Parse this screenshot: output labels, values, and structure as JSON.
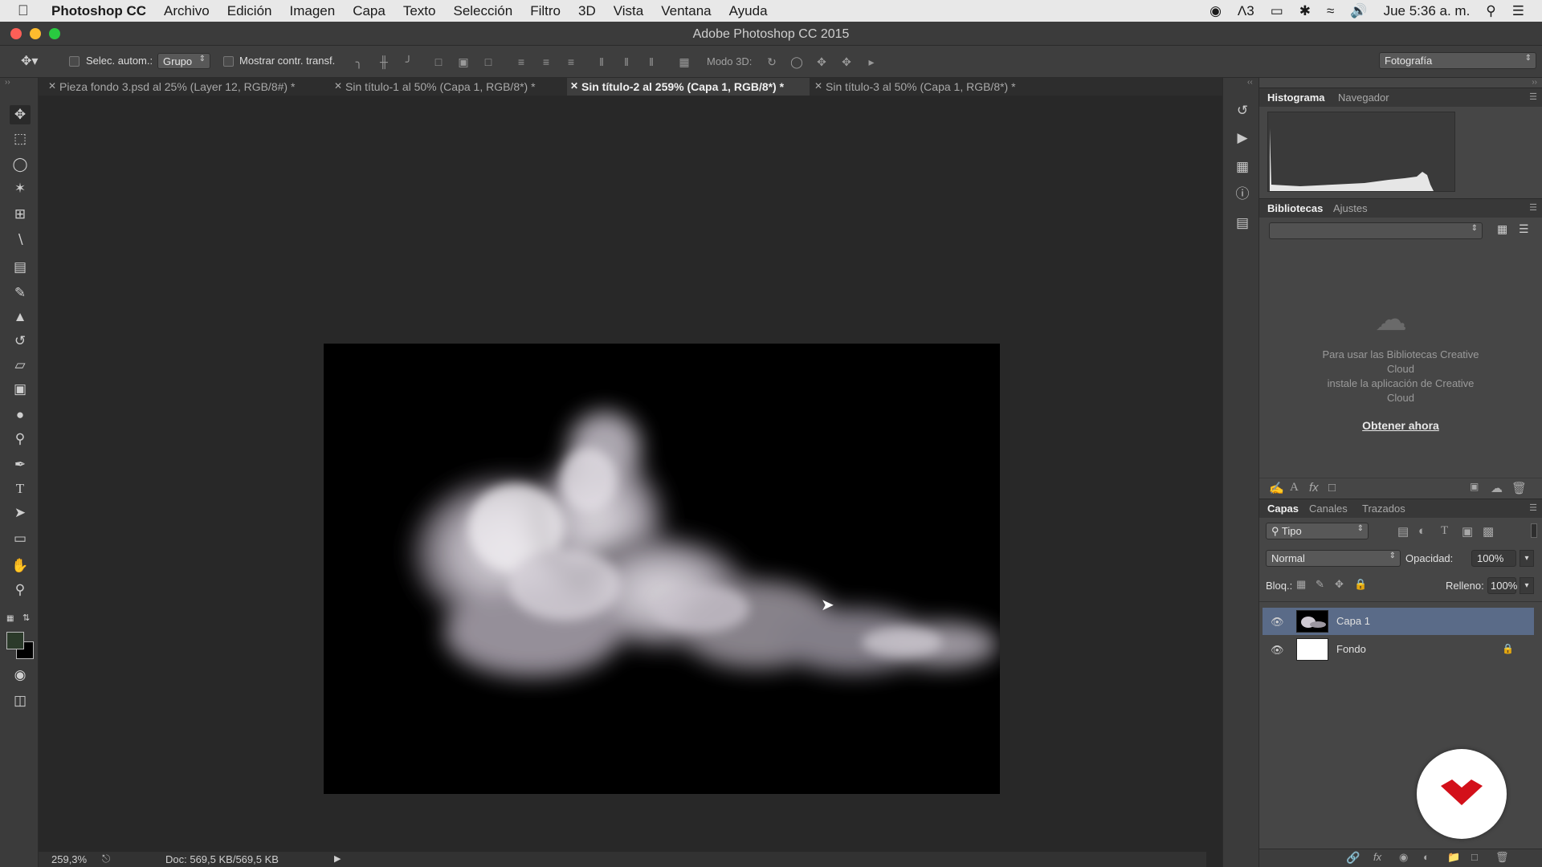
{
  "menubar": {
    "apple_icon": "apple-icon",
    "app_name": "Photoshop CC",
    "items": [
      "Archivo",
      "Edición",
      "Imagen",
      "Capa",
      "Texto",
      "Selección",
      "Filtro",
      "3D",
      "Vista",
      "Ventana",
      "Ayuda"
    ],
    "status": {
      "adobe_count": "3",
      "datetime": "Jue 5:36 a. m."
    }
  },
  "window": {
    "title": "Adobe Photoshop CC 2015",
    "close_color": "#fc5f57",
    "minimize_color": "#fdbc2e",
    "zoom_color": "#29c940"
  },
  "options_bar": {
    "auto_select_label": "Selec. autom.:",
    "auto_select_target": "Grupo",
    "show_transform_label": "Mostrar contr. transf.",
    "mode_3d_label": "Modo 3D:",
    "workspace": "Fotografía"
  },
  "tabs": [
    {
      "label": "Pieza fondo 3.psd al 25% (Layer 12, RGB/8#) *",
      "active": false
    },
    {
      "label": "Sin título-1 al 50% (Capa 1, RGB/8*) *",
      "active": false
    },
    {
      "label": "Sin título-2 al 259% (Capa 1, RGB/8*) *",
      "active": true
    },
    {
      "label": "Sin título-3 al 50% (Capa 1, RGB/8*) *",
      "active": false
    }
  ],
  "status_bar": {
    "zoom": "259,3%",
    "doc_size": "Doc: 569,5 KB/569,5 KB"
  },
  "histogram_panel": {
    "tabs": [
      "Histograma",
      "Navegador"
    ]
  },
  "libraries_panel": {
    "tabs": [
      "Bibliotecas",
      "Ajustes"
    ],
    "message_lines": [
      "Para usar las Bibliotecas Creative",
      "Cloud",
      "instale la aplicación de Creative",
      "Cloud"
    ],
    "cta": "Obtener ahora"
  },
  "layers_panel": {
    "tabs": [
      "Capas",
      "Canales",
      "Trazados"
    ],
    "filter": "Tipo",
    "blend_mode": "Normal",
    "opacity_label": "Opacidad:",
    "opacity": "100%",
    "lock_label": "Bloq.:",
    "fill_label": "Relleno:",
    "fill": "100%",
    "layers": [
      {
        "name": "Capa 1",
        "selected": true
      },
      {
        "name": "Fondo",
        "selected": false,
        "locked": true
      }
    ]
  },
  "colors": {
    "selected_layer": "#5a6b88",
    "watermark_red": "#d3101a"
  }
}
